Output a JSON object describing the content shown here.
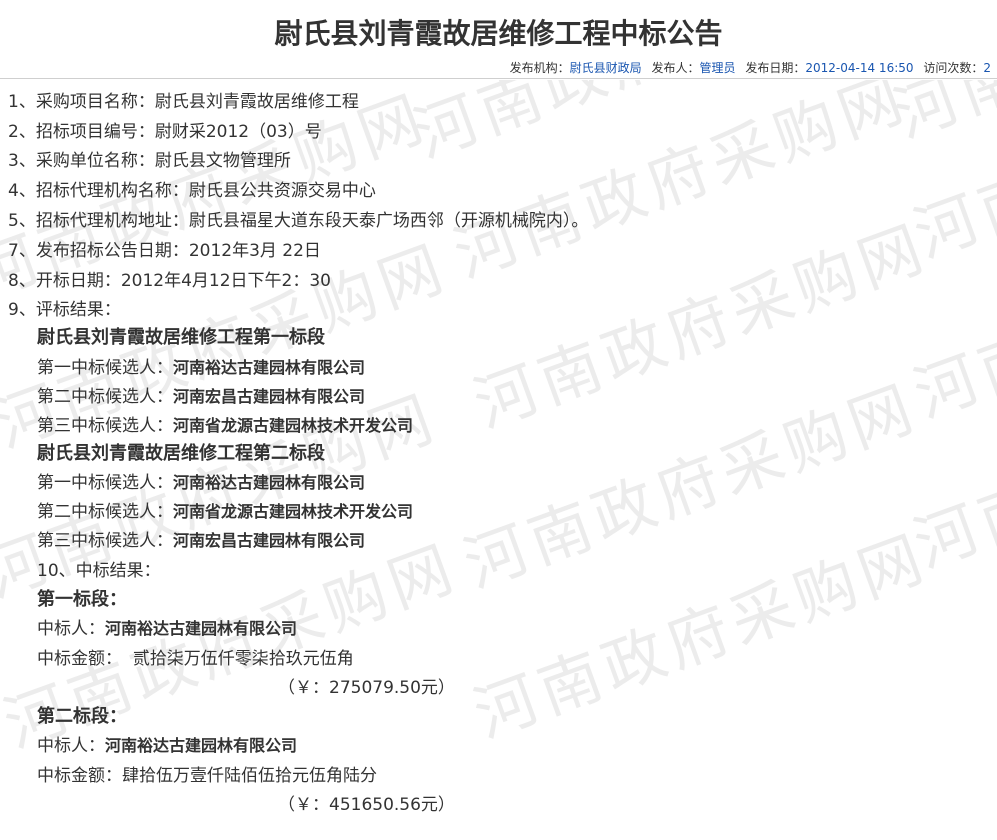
{
  "title": "尉氏县刘青霞故居维修工程中标公告",
  "meta": {
    "org_label": "发布机构：",
    "org_value": "尉氏县财政局",
    "publisher_label": "发布人：",
    "publisher_value": "管理员",
    "date_label": "发布日期：",
    "date_value": "2012-04-14 16:50",
    "visits_label": "访问次数：",
    "visits_value": "2"
  },
  "watermark": "河南政府采购网",
  "lines": [
    "1、采购项目名称：尉氏县刘青霞故居维修工程",
    "2、招标项目编号：尉财采2012（03）号",
    "3、采购单位名称：尉氏县文物管理所",
    "4、招标代理机构名称：尉氏县公共资源交易中心",
    "5、招标代理机构地址：尉氏县福星大道东段天泰广场西邻（开源机械院内）。",
    "7、发布招标公告日期：2012年3月 22日",
    "8、开标日期：2012年4月12日下午2：30",
    "9、评标结果："
  ],
  "bid_results": {
    "section1_title": "尉氏县刘青霞故居维修工程第一标段",
    "section1": [
      {
        "label": "第一中标候选人：",
        "company": "河南裕达古建园林有限公司"
      },
      {
        "label": "第二中标候选人：",
        "company": "河南宏昌古建园林有限公司"
      },
      {
        "label": "第三中标候选人：",
        "company": "河南省龙源古建园林技术开发公司"
      }
    ],
    "section2_title": "尉氏县刘青霞故居维修工程第二标段",
    "section2": [
      {
        "label": "第一中标候选人：",
        "company": "河南裕达古建园林有限公司"
      },
      {
        "label": "第二中标候选人：",
        "company": "河南省龙源古建园林技术开发公司"
      },
      {
        "label": "第三中标候选人：",
        "company": "河南宏昌古建园林有限公司"
      }
    ]
  },
  "award": {
    "heading": "10、中标结果：",
    "lot1_title": "第一标段：",
    "lot1_winner_label": "中标人：",
    "lot1_winner": "河南裕达古建园林有限公司",
    "lot1_amount_label": "中标金额：",
    "lot1_amount_words": "贰拾柒万伍仟零柒拾玖元伍角",
    "lot1_amount_num": "（￥：275079.50元）",
    "lot2_title": "第二标段：",
    "lot2_winner_label": "中标人：",
    "lot2_winner": "河南裕达古建园林有限公司",
    "lot2_amount_label": "中标金额：",
    "lot2_amount_words": "肆拾伍万壹仟陆佰伍拾元伍角陆分",
    "lot2_amount_num": "（￥：451650.56元）"
  }
}
